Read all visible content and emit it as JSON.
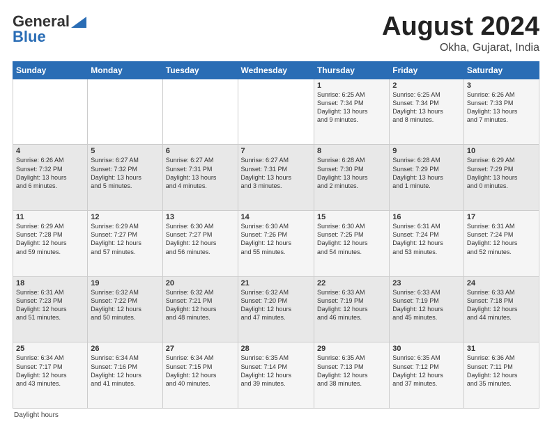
{
  "header": {
    "logo_general": "General",
    "logo_blue": "Blue",
    "month_title": "August 2024",
    "location": "Okha, Gujarat, India"
  },
  "weekdays": [
    "Sunday",
    "Monday",
    "Tuesday",
    "Wednesday",
    "Thursday",
    "Friday",
    "Saturday"
  ],
  "footer": {
    "daylight_label": "Daylight hours"
  },
  "rows": [
    [
      {
        "day": "",
        "info": ""
      },
      {
        "day": "",
        "info": ""
      },
      {
        "day": "",
        "info": ""
      },
      {
        "day": "",
        "info": ""
      },
      {
        "day": "1",
        "info": "Sunrise: 6:25 AM\nSunset: 7:34 PM\nDaylight: 13 hours\nand 9 minutes."
      },
      {
        "day": "2",
        "info": "Sunrise: 6:25 AM\nSunset: 7:34 PM\nDaylight: 13 hours\nand 8 minutes."
      },
      {
        "day": "3",
        "info": "Sunrise: 6:26 AM\nSunset: 7:33 PM\nDaylight: 13 hours\nand 7 minutes."
      }
    ],
    [
      {
        "day": "4",
        "info": "Sunrise: 6:26 AM\nSunset: 7:32 PM\nDaylight: 13 hours\nand 6 minutes."
      },
      {
        "day": "5",
        "info": "Sunrise: 6:27 AM\nSunset: 7:32 PM\nDaylight: 13 hours\nand 5 minutes."
      },
      {
        "day": "6",
        "info": "Sunrise: 6:27 AM\nSunset: 7:31 PM\nDaylight: 13 hours\nand 4 minutes."
      },
      {
        "day": "7",
        "info": "Sunrise: 6:27 AM\nSunset: 7:31 PM\nDaylight: 13 hours\nand 3 minutes."
      },
      {
        "day": "8",
        "info": "Sunrise: 6:28 AM\nSunset: 7:30 PM\nDaylight: 13 hours\nand 2 minutes."
      },
      {
        "day": "9",
        "info": "Sunrise: 6:28 AM\nSunset: 7:29 PM\nDaylight: 13 hours\nand 1 minute."
      },
      {
        "day": "10",
        "info": "Sunrise: 6:29 AM\nSunset: 7:29 PM\nDaylight: 13 hours\nand 0 minutes."
      }
    ],
    [
      {
        "day": "11",
        "info": "Sunrise: 6:29 AM\nSunset: 7:28 PM\nDaylight: 12 hours\nand 59 minutes."
      },
      {
        "day": "12",
        "info": "Sunrise: 6:29 AM\nSunset: 7:27 PM\nDaylight: 12 hours\nand 57 minutes."
      },
      {
        "day": "13",
        "info": "Sunrise: 6:30 AM\nSunset: 7:27 PM\nDaylight: 12 hours\nand 56 minutes."
      },
      {
        "day": "14",
        "info": "Sunrise: 6:30 AM\nSunset: 7:26 PM\nDaylight: 12 hours\nand 55 minutes."
      },
      {
        "day": "15",
        "info": "Sunrise: 6:30 AM\nSunset: 7:25 PM\nDaylight: 12 hours\nand 54 minutes."
      },
      {
        "day": "16",
        "info": "Sunrise: 6:31 AM\nSunset: 7:24 PM\nDaylight: 12 hours\nand 53 minutes."
      },
      {
        "day": "17",
        "info": "Sunrise: 6:31 AM\nSunset: 7:24 PM\nDaylight: 12 hours\nand 52 minutes."
      }
    ],
    [
      {
        "day": "18",
        "info": "Sunrise: 6:31 AM\nSunset: 7:23 PM\nDaylight: 12 hours\nand 51 minutes."
      },
      {
        "day": "19",
        "info": "Sunrise: 6:32 AM\nSunset: 7:22 PM\nDaylight: 12 hours\nand 50 minutes."
      },
      {
        "day": "20",
        "info": "Sunrise: 6:32 AM\nSunset: 7:21 PM\nDaylight: 12 hours\nand 48 minutes."
      },
      {
        "day": "21",
        "info": "Sunrise: 6:32 AM\nSunset: 7:20 PM\nDaylight: 12 hours\nand 47 minutes."
      },
      {
        "day": "22",
        "info": "Sunrise: 6:33 AM\nSunset: 7:19 PM\nDaylight: 12 hours\nand 46 minutes."
      },
      {
        "day": "23",
        "info": "Sunrise: 6:33 AM\nSunset: 7:19 PM\nDaylight: 12 hours\nand 45 minutes."
      },
      {
        "day": "24",
        "info": "Sunrise: 6:33 AM\nSunset: 7:18 PM\nDaylight: 12 hours\nand 44 minutes."
      }
    ],
    [
      {
        "day": "25",
        "info": "Sunrise: 6:34 AM\nSunset: 7:17 PM\nDaylight: 12 hours\nand 43 minutes."
      },
      {
        "day": "26",
        "info": "Sunrise: 6:34 AM\nSunset: 7:16 PM\nDaylight: 12 hours\nand 41 minutes."
      },
      {
        "day": "27",
        "info": "Sunrise: 6:34 AM\nSunset: 7:15 PM\nDaylight: 12 hours\nand 40 minutes."
      },
      {
        "day": "28",
        "info": "Sunrise: 6:35 AM\nSunset: 7:14 PM\nDaylight: 12 hours\nand 39 minutes."
      },
      {
        "day": "29",
        "info": "Sunrise: 6:35 AM\nSunset: 7:13 PM\nDaylight: 12 hours\nand 38 minutes."
      },
      {
        "day": "30",
        "info": "Sunrise: 6:35 AM\nSunset: 7:12 PM\nDaylight: 12 hours\nand 37 minutes."
      },
      {
        "day": "31",
        "info": "Sunrise: 6:36 AM\nSunset: 7:11 PM\nDaylight: 12 hours\nand 35 minutes."
      }
    ]
  ]
}
